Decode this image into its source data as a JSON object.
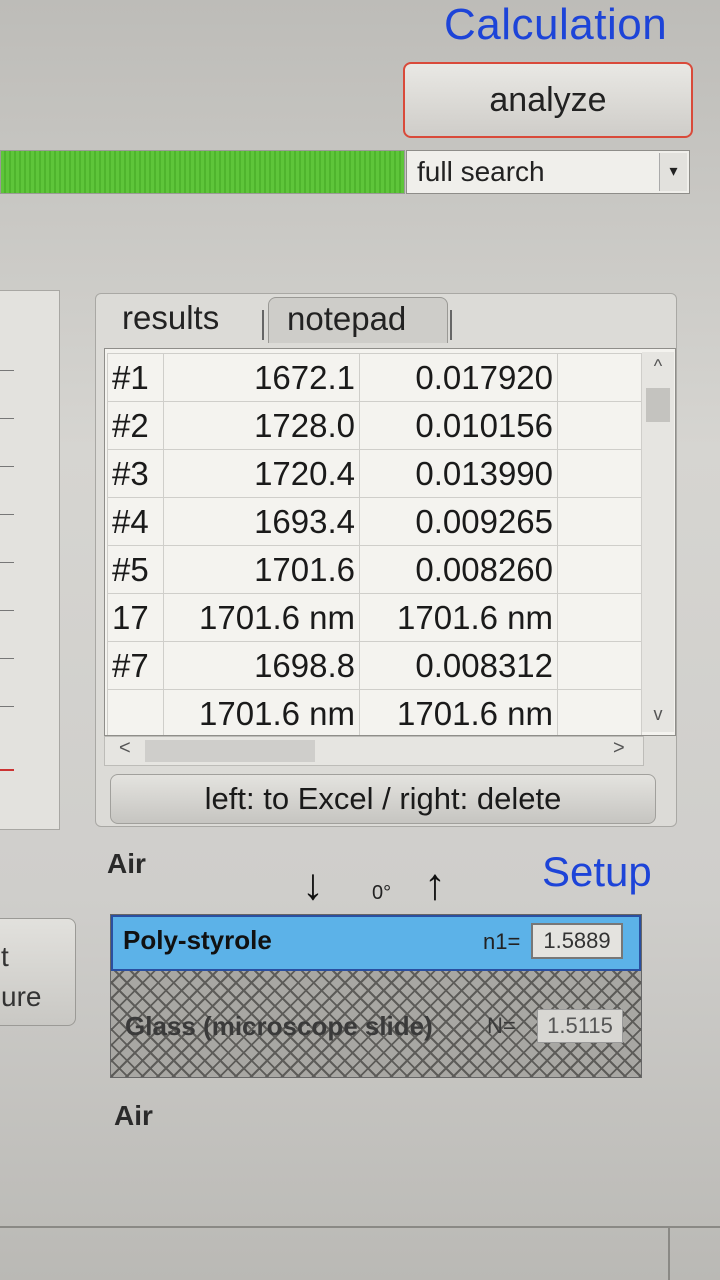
{
  "header": {
    "title": "Calculation",
    "analyze_label": "analyze",
    "progress_percent": 100,
    "search_mode": "full search"
  },
  "left_panel": {
    "button_text_line1": "t",
    "button_text_line2": "ure"
  },
  "results": {
    "tabs": [
      {
        "label": "results",
        "active": true
      },
      {
        "label": "notepad",
        "active": false
      }
    ],
    "rows": [
      [
        "#1",
        "1672.1",
        "0.017920",
        ""
      ],
      [
        "#2",
        "1728.0",
        "0.010156",
        ""
      ],
      [
        "#3",
        "1720.4",
        "0.013990",
        ""
      ],
      [
        "#4",
        "1693.4",
        "0.009265",
        ""
      ],
      [
        "#5",
        "1701.6",
        "0.008260",
        ""
      ],
      [
        "17",
        "1701.6 nm",
        "1701.6 nm",
        ""
      ],
      [
        "#7",
        "1698.8",
        "0.008312",
        ""
      ],
      [
        "",
        "1701.6 nm",
        "1701.6 nm",
        ""
      ]
    ],
    "excel_button_label": "left: to Excel / right: delete",
    "scroll_up_glyph": "^",
    "scroll_down_glyph": "v",
    "scroll_left_glyph": "<",
    "scroll_right_glyph": ">"
  },
  "setup": {
    "title": "Setup",
    "medium_top": "Air",
    "medium_bottom": "Air",
    "angle": "0°",
    "arrow_down": "↓",
    "arrow_up": "↑",
    "layers": [
      {
        "name": "Poly-styrole",
        "n_label": "n1=",
        "n_value": "1.5889",
        "color": "#5cb2e8"
      },
      {
        "name": "Glass (microscope slide)",
        "n_label": "N=",
        "n_value": "1.5115",
        "color": "#a8a7a3"
      }
    ]
  },
  "colors": {
    "accent_blue": "#1d44d8",
    "progress_green": "#5ec53a",
    "analyze_border": "#d94a3a"
  }
}
